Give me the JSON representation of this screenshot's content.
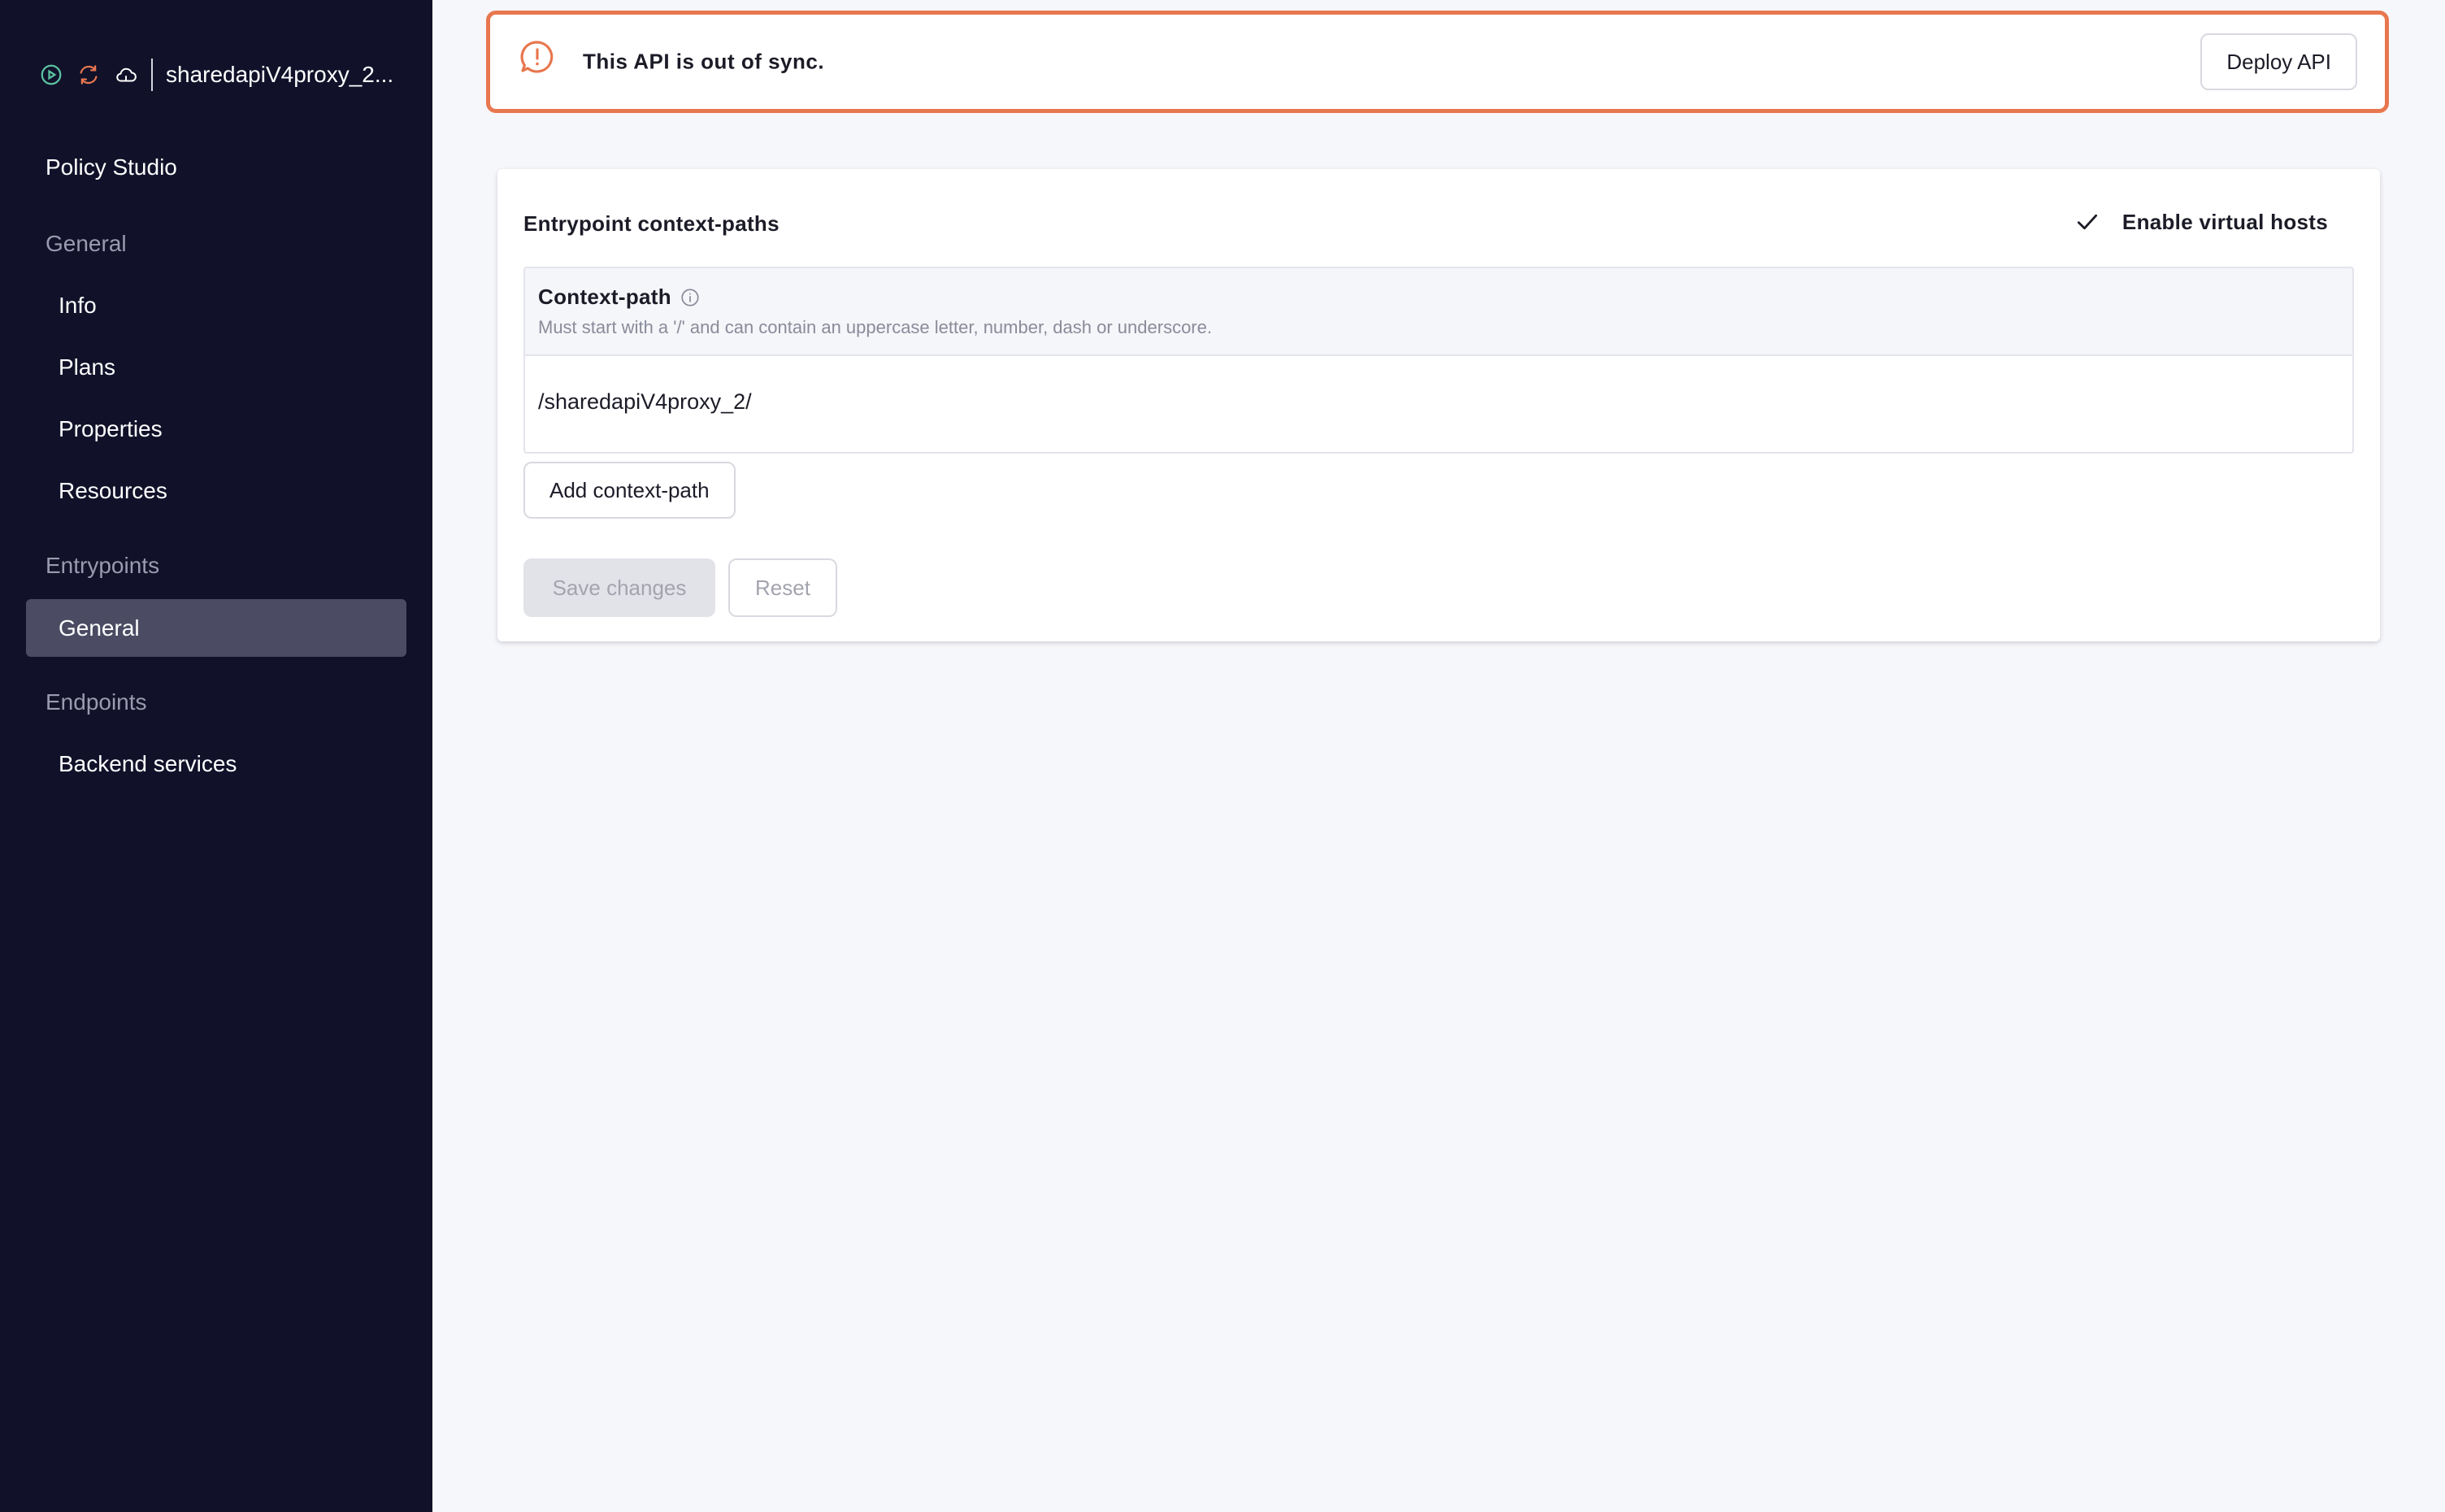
{
  "sidebar": {
    "api_name": "sharedapiV4proxy_2...",
    "status_icons": [
      "play-circle-icon",
      "sync-icon",
      "cloud-icon"
    ],
    "items": {
      "policy_studio": "Policy Studio",
      "general_section": "General",
      "info": "Info",
      "plans": "Plans",
      "properties": "Properties",
      "resources": "Resources",
      "entrypoints_section": "Entrypoints",
      "entrypoints_general": "General",
      "endpoints_section": "Endpoints",
      "backend_services": "Backend services"
    }
  },
  "alert": {
    "icon": "alert-chat-icon",
    "message": "This API is out of sync.",
    "deploy_label": "Deploy API",
    "color": "#e8774f"
  },
  "card": {
    "title": "Entrypoint context-paths",
    "virtual_hosts_label": "Enable virtual hosts",
    "context_path": {
      "header": "Context-path",
      "hint": "Must start with a '/' and can contain an uppercase letter, number, dash or underscore.",
      "value": "/sharedapiV4proxy_2/"
    },
    "add_label": "Add context-path",
    "save_label": "Save changes",
    "reset_label": "Reset"
  },
  "colors": {
    "sidebar_bg": "#11112a",
    "sidebar_active": "#4b4c63",
    "status_green": "#5bc3a0",
    "status_orange": "#e8774f",
    "page_bg": "#f6f7fb"
  }
}
